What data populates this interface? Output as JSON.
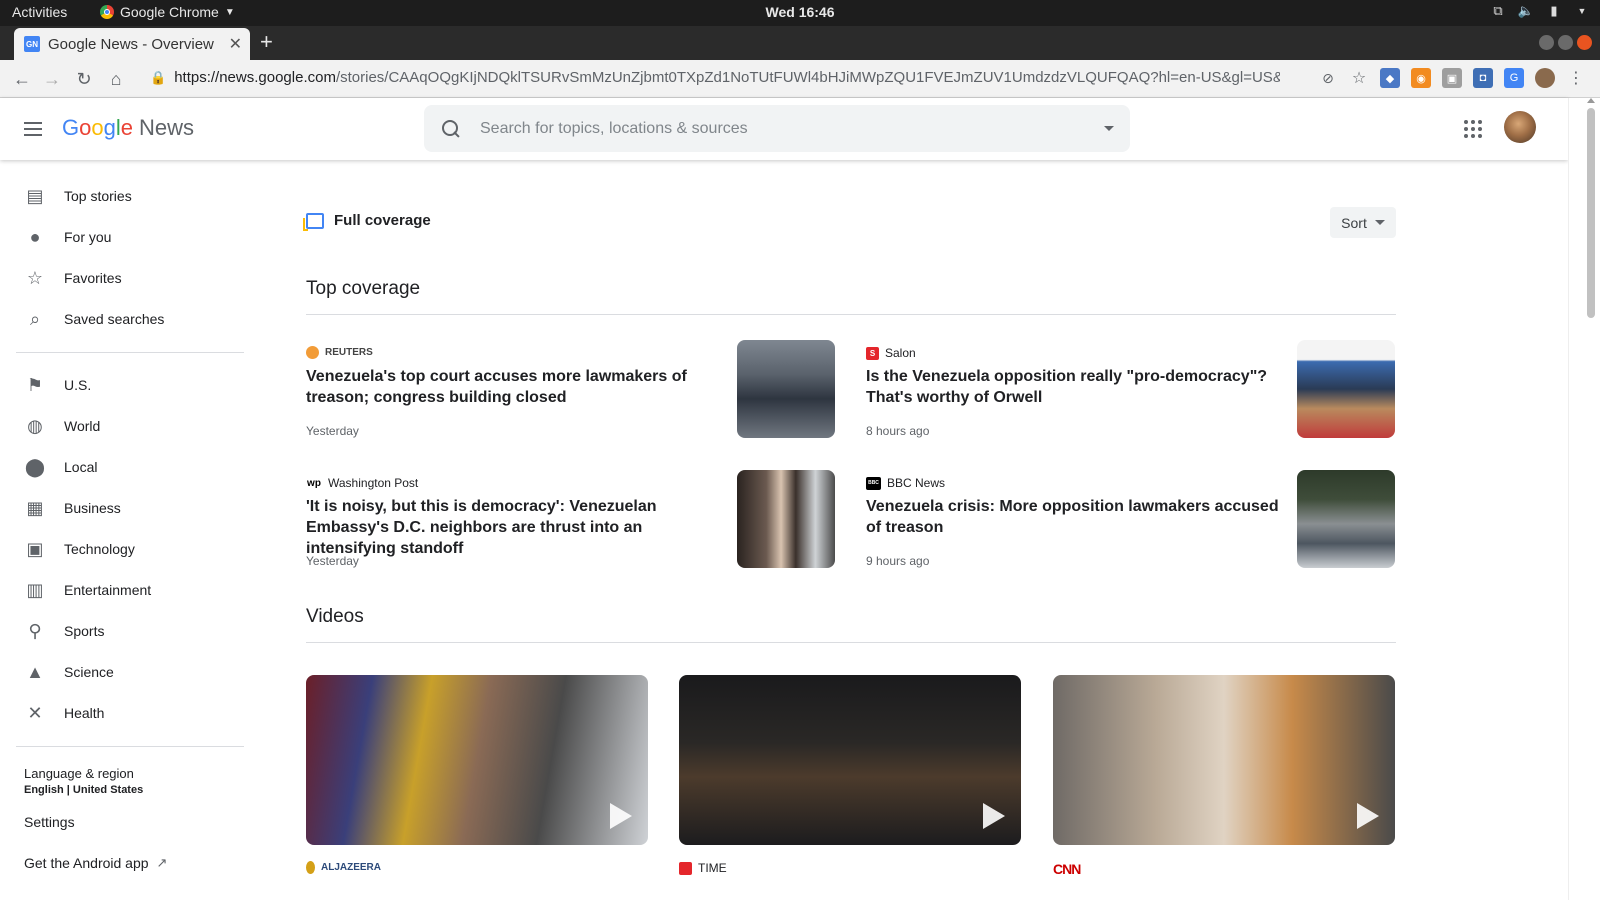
{
  "os_bar": {
    "activities": "Activities",
    "app_name": "Google Chrome",
    "clock": "Wed 16:46"
  },
  "browser": {
    "tab_title": "Google News - Overview",
    "url_host": "https://news.google.com",
    "url_path": "/stories/CAAqOQgKIjNDQklTSURvSmMzUnZjbmt0TXpZd1NoTUtFUWl4bHJiMWpZQU1FVEJmZUV1UmdzdzVLQUFQAQ?hl=en-US&gl=US&ceid=US..."
  },
  "header": {
    "logo_google": [
      "G",
      "o",
      "o",
      "g",
      "l",
      "e"
    ],
    "logo_news": "News",
    "search_placeholder": "Search for topics, locations & sources"
  },
  "sidebar": {
    "primary": [
      {
        "label": "Top stories",
        "icon": "newspaper-icon"
      },
      {
        "label": "For you",
        "icon": "person-icon"
      },
      {
        "label": "Favorites",
        "icon": "star-icon"
      },
      {
        "label": "Saved searches",
        "icon": "search-icon"
      }
    ],
    "sections": [
      {
        "label": "U.S.",
        "icon": "flag-icon"
      },
      {
        "label": "World",
        "icon": "globe-icon"
      },
      {
        "label": "Local",
        "icon": "location-pin-icon"
      },
      {
        "label": "Business",
        "icon": "building-icon"
      },
      {
        "label": "Technology",
        "icon": "chip-icon"
      },
      {
        "label": "Entertainment",
        "icon": "film-icon"
      },
      {
        "label": "Sports",
        "icon": "bicycle-icon"
      },
      {
        "label": "Science",
        "icon": "flask-icon"
      },
      {
        "label": "Health",
        "icon": "wrench-icon"
      }
    ],
    "language_title": "Language & region",
    "language_value": "English | United States",
    "settings": "Settings",
    "android_app": "Get the Android app"
  },
  "main": {
    "full_coverage": "Full coverage",
    "sort": "Sort",
    "top_coverage_title": "Top coverage",
    "stories": [
      {
        "source": "REUTERS",
        "headline": "Venezuela's top court accuses more lawmakers of treason; congress building closed",
        "time": "Yesterday",
        "logo_color": "#f29c38"
      },
      {
        "source": "Salon",
        "headline": "Is the Venezuela opposition really \"pro-democracy\"? That's worthy of Orwell",
        "time": "8 hours ago",
        "logo_color": "#e4262b"
      },
      {
        "source": "Washington Post",
        "headline": "'It is noisy, but this is democracy': Venezuelan Embassy's D.C. neighbors are thrust into an intensifying standoff",
        "time": "Yesterday",
        "logo_color": "#000000"
      },
      {
        "source": "BBC News",
        "headline": "Venezuela crisis: More opposition lawmakers accused of treason",
        "time": "9 hours ago",
        "logo_color": "#000000"
      }
    ],
    "videos_title": "Videos",
    "videos": [
      {
        "source": "ALJAZEERA",
        "logo_color": "#d4a017"
      },
      {
        "source": "TIME",
        "logo_color": "#e4262b"
      },
      {
        "source": "CNN",
        "logo_color": "#cc0000"
      }
    ]
  }
}
